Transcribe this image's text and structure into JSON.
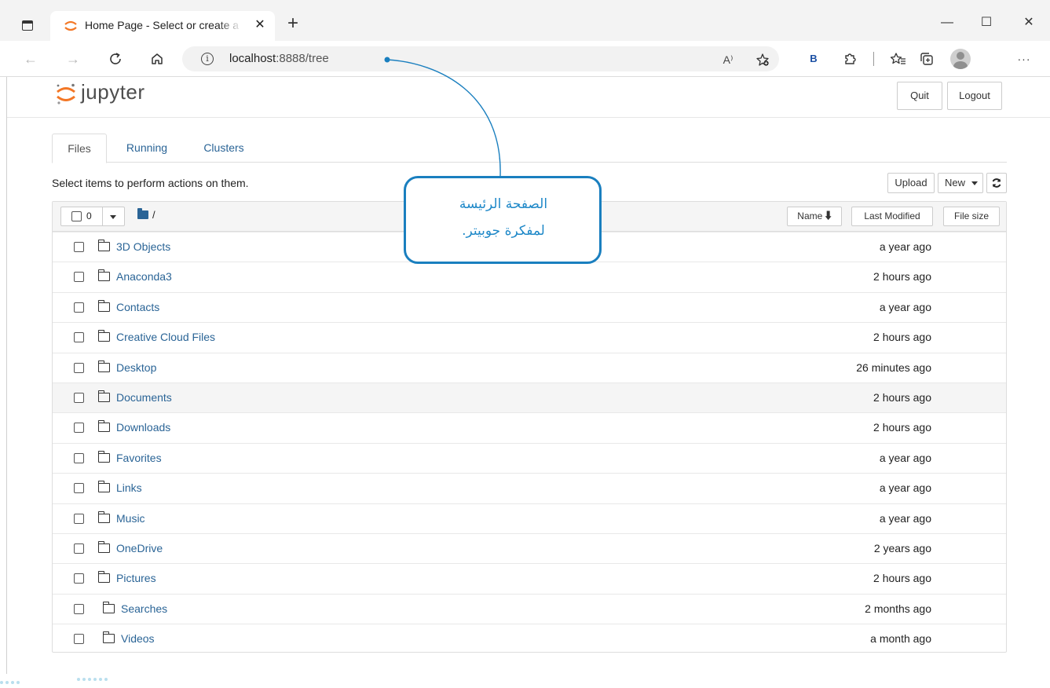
{
  "browser": {
    "tab_title": "Home Page - Select or create a n",
    "tab_close": "✕",
    "new_tab": "+",
    "url_host": "localhost",
    "url_path": ":8888/tree",
    "read_aloud_icon": "A⁾",
    "profile_letter": "B",
    "window_controls": [
      "—",
      "☐",
      "✕"
    ]
  },
  "jupyter": {
    "logo_text": "jupyter",
    "quit_label": "Quit",
    "logout_label": "Logout",
    "tabs": [
      "Files",
      "Running",
      "Clusters"
    ],
    "active_tab": "Files",
    "instructions": "Select items to perform actions on them.",
    "upload_label": "Upload",
    "new_label": "New",
    "refresh_icon": "refresh-icon",
    "selected_count": "0",
    "breadcrumb": "/",
    "columns": {
      "name": "Name",
      "last_modified": "Last Modified",
      "file_size": "File size"
    },
    "items": [
      {
        "name": "3D Objects",
        "modified": "a year ago"
      },
      {
        "name": "Anaconda3",
        "modified": "2 hours ago"
      },
      {
        "name": "Contacts",
        "modified": "a year ago"
      },
      {
        "name": "Creative Cloud Files",
        "modified": "2 hours ago"
      },
      {
        "name": "Desktop",
        "modified": "26 minutes ago"
      },
      {
        "name": "Documents",
        "modified": "2 hours ago"
      },
      {
        "name": "Downloads",
        "modified": "2 hours ago"
      },
      {
        "name": "Favorites",
        "modified": "a year ago"
      },
      {
        "name": "Links",
        "modified": "a year ago"
      },
      {
        "name": "Music",
        "modified": "a year ago"
      },
      {
        "name": "OneDrive",
        "modified": "2 years ago"
      },
      {
        "name": "Pictures",
        "modified": "2 hours ago"
      },
      {
        "name": "Searches",
        "modified": "2 months ago"
      },
      {
        "name": "Videos",
        "modified": "a month ago"
      }
    ]
  },
  "callout": {
    "line1": "الصفحة الرئيسة",
    "line2": "لمفكرة جوبيتر."
  },
  "colors": {
    "link": "#2a6496",
    "callout": "#1a7fbf",
    "jupyter_orange": "#f37726"
  }
}
